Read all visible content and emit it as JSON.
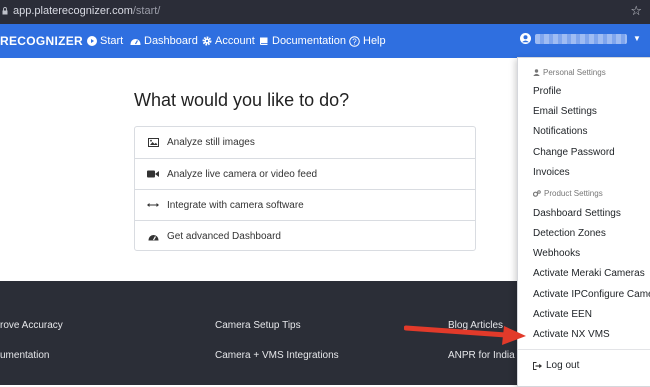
{
  "browser": {
    "url_host": "app.platerecognizer.com",
    "url_path": "/start/"
  },
  "navbar": {
    "brand": "RECOGNIZER",
    "start": "Start",
    "dashboard": "Dashboard",
    "account": "Account",
    "documentation": "Documentation",
    "help": "Help"
  },
  "main": {
    "title": "What would you like to do?",
    "options": [
      "Analyze still images",
      "Analyze live camera or video feed",
      "Integrate with camera software",
      "Get advanced Dashboard"
    ]
  },
  "footer": {
    "col1": [
      "rove Accuracy",
      "umentation"
    ],
    "col2": [
      "Camera Setup Tips",
      "Camera + VMS Integrations"
    ],
    "col3": [
      "Blog Articles",
      "ANPR for India"
    ]
  },
  "dropdown": {
    "personal_header": "Personal Settings",
    "personal_items": [
      "Profile",
      "Email Settings",
      "Notifications",
      "Change Password",
      "Invoices"
    ],
    "product_header": "Product Settings",
    "product_items": [
      "Dashboard Settings",
      "Detection Zones",
      "Webhooks",
      "Activate Meraki Cameras",
      "Activate IPConfigure Came",
      "Activate EEN",
      "Activate NX VMS"
    ],
    "logout": "Log out"
  },
  "colors": {
    "navbar": "#2f6fe0",
    "footer": "#2b2e37",
    "arrow": "#e23a2a"
  }
}
